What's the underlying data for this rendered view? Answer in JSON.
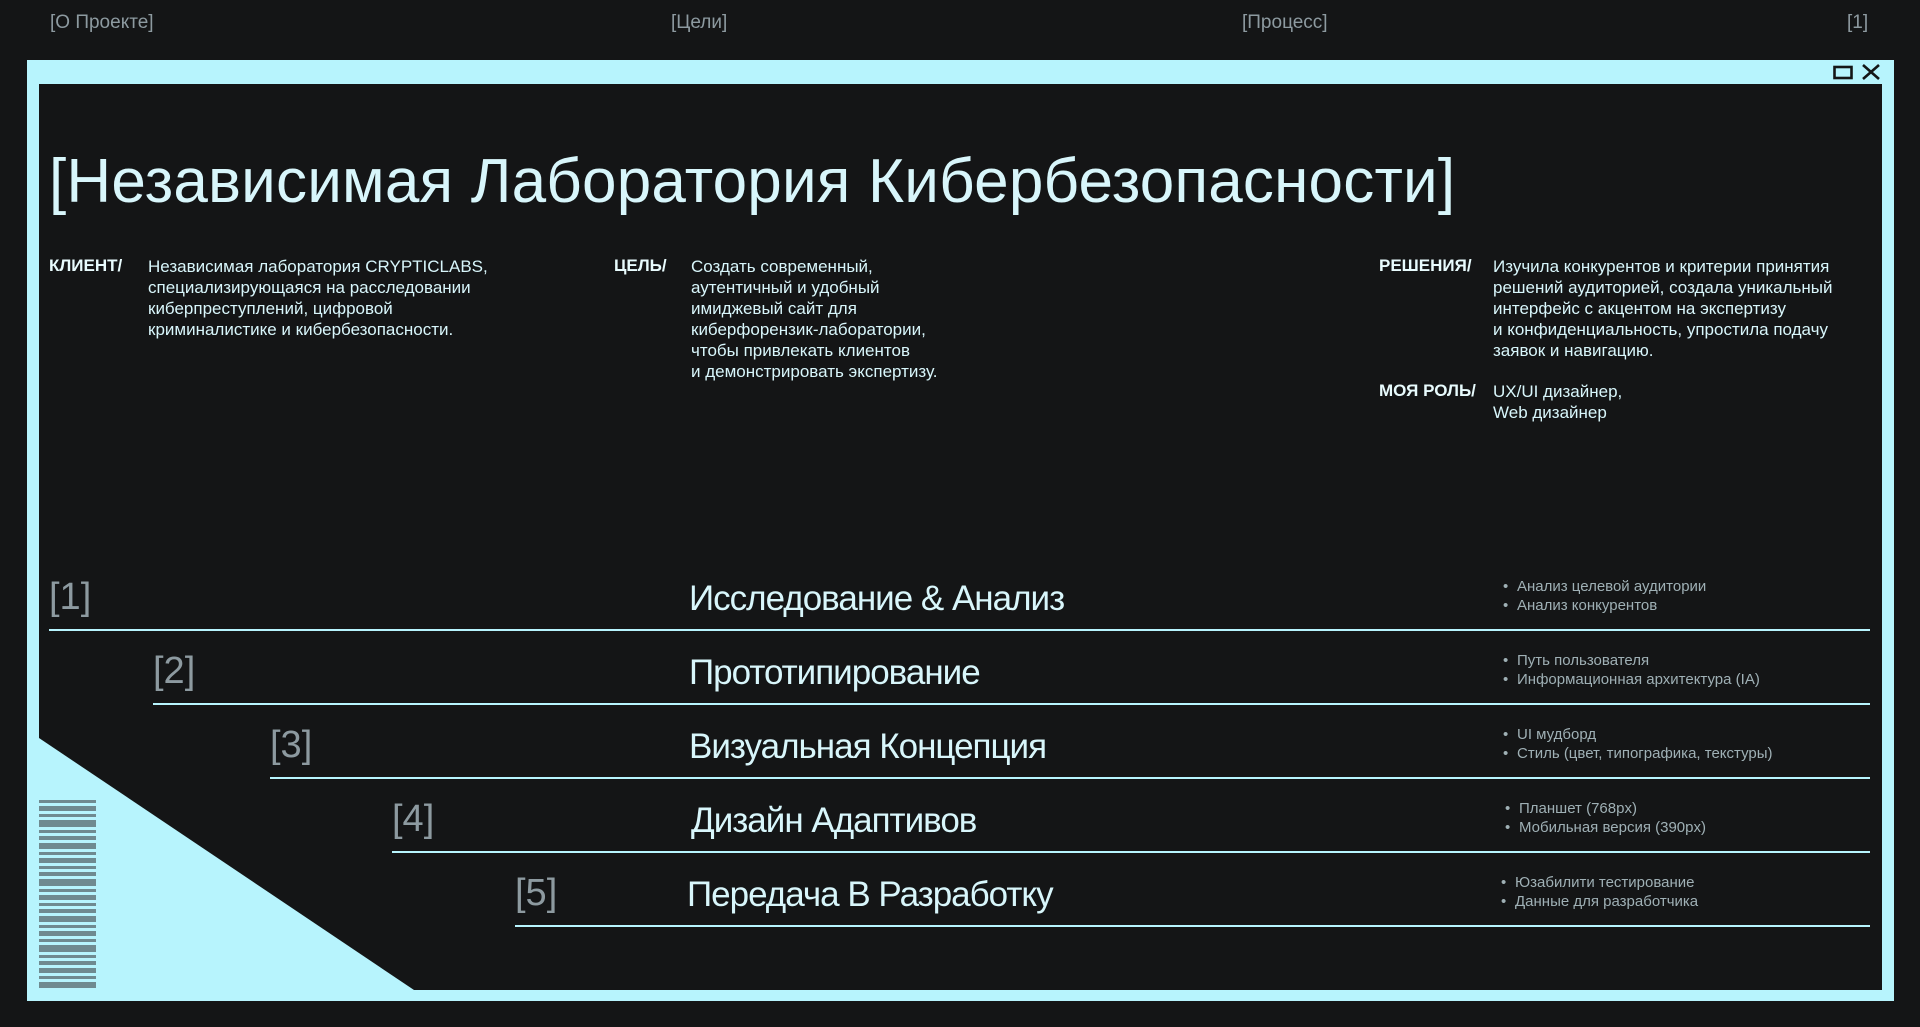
{
  "nav": {
    "about": "[О Проекте]",
    "goals": "[Цели]",
    "process": "[Процесс]",
    "page": "[1]"
  },
  "title": "[Независимая Лаборатория Кибербезопасности]",
  "client": {
    "label": "КЛИЕНТ/",
    "lines": [
      "Независимая лаборатория CRYPTICLABS,",
      "специализирующаяся на расследовании",
      "киберпреступлений, цифровой",
      "криминалистике и кибербезопасности."
    ]
  },
  "goal": {
    "label": "ЦЕЛЬ/",
    "lines": [
      "Создать современный,",
      "аутентичный и удобный",
      "имиджевый сайт для",
      "киберфорензик-лаборатории,",
      "чтобы привлекать клиентов",
      "и демонстрировать экспертизу."
    ]
  },
  "solutions": {
    "label": "РЕШЕНИЯ/",
    "lines": [
      "Изучила конкурентов и критерии принятия",
      "решений аудиторией, создала уникальный",
      "интерфейс с акцентом на экспертизу",
      "и конфиденциальность, упростила подачу",
      "заявок и навигацию."
    ]
  },
  "role": {
    "label": "МОЯ РОЛЬ/",
    "lines": [
      "UX/UI дизайнер,",
      "Web дизайнер"
    ]
  },
  "steps": [
    {
      "num": "[1]",
      "title": "Исследование & Анализ",
      "bullets": [
        "Анализ целевой аудитории",
        "Анализ конкурентов"
      ]
    },
    {
      "num": "[2]",
      "title": "Прототипирование",
      "bullets": [
        "Путь пользователя",
        "Информационная архитектура (IA)"
      ]
    },
    {
      "num": "[3]",
      "title": "Визуальная Концепция",
      "bullets": [
        "UI мудборд",
        "Стиль (цвет, типографика, текстуры)"
      ]
    },
    {
      "num": "[4]",
      "title": "Дизайн Адаптивов",
      "bullets": [
        "Планшет (768px)",
        "Мобильная версия (390px)"
      ]
    },
    {
      "num": "[5]",
      "title": "Передача В Разработку",
      "bullets": [
        "Юзабилити тестирование",
        "Данные для разработчика"
      ]
    }
  ],
  "colors": {
    "background": "#141516",
    "accent": "#b7f4fd",
    "text": "#d8f6fb",
    "muted": "#8d9aa0",
    "barcode": "#6f8a90"
  },
  "icons": [
    "maximize-icon",
    "close-icon",
    "barcode-decoration"
  ]
}
